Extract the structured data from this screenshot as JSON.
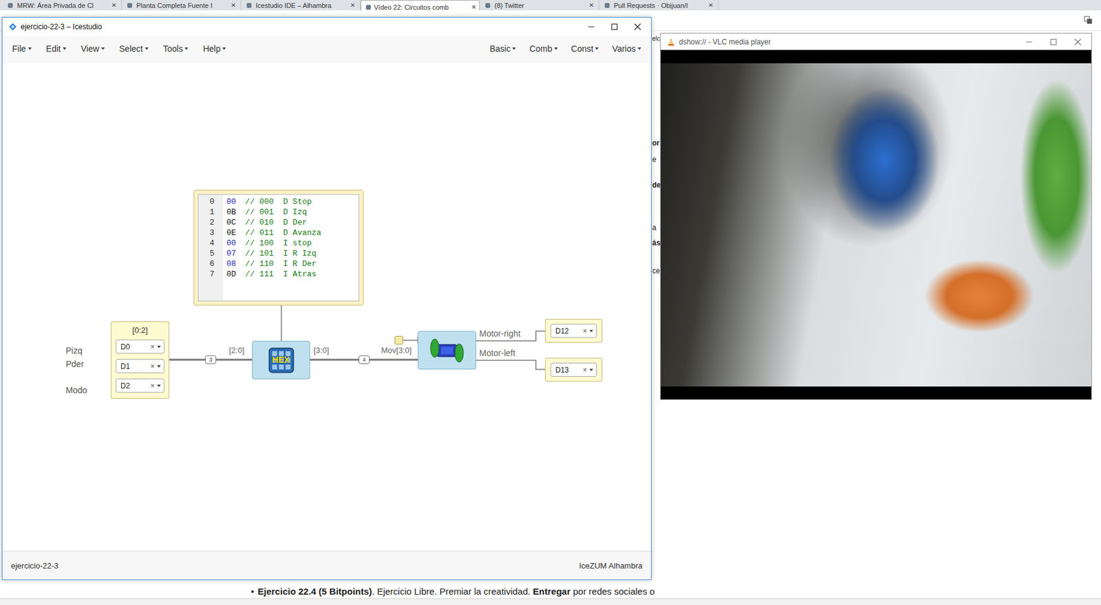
{
  "browser": {
    "tabs": [
      {
        "label": "MRW: Área Privada de Cl",
        "close": "✕",
        "selected": false
      },
      {
        "label": "Planta Completa Fuente I",
        "close": "✕",
        "selected": false
      },
      {
        "label": "Icestudio IDE – Alhambra",
        "close": "✕",
        "selected": false
      },
      {
        "label": "Vídeo 22: Circuitos comb",
        "close": "✕",
        "selected": true
      },
      {
        "label": "(8) Twitter",
        "close": "✕",
        "selected": false
      },
      {
        "label": "Pull Requests · Obijuan/I",
        "close": "✕",
        "selected": false
      }
    ]
  },
  "page": {
    "side": "elc",
    "fragments": [
      "or",
      "e",
      "de",
      "a",
      "ás",
      "ce"
    ],
    "bullet": {
      "mark": "•",
      "bold": "Ejercicio 22.4 (5 Bitpoints)",
      "text": ". Ejercicio Libre. Premiar la creatividad. ",
      "bold2": "Entregar",
      "rest": " por redes sociales o"
    }
  },
  "icestudio": {
    "title": "ejercicio-22-3 – Icestudio",
    "menu_left": [
      "File",
      "Edit",
      "View",
      "Select",
      "Tools",
      "Help"
    ],
    "menu_right": [
      "Basic",
      "Comb",
      "Const",
      "Varios"
    ],
    "memory": {
      "lines": [
        {
          "n": "0",
          "value": "00",
          "comment": "// 000  D Stop"
        },
        {
          "n": "1",
          "value": "0B",
          "comment": "// 001  D Izq"
        },
        {
          "n": "2",
          "value": "0C",
          "comment": "// 010  D Der"
        },
        {
          "n": "3",
          "value": "0E",
          "comment": "// 011  D Avanza"
        },
        {
          "n": "4",
          "value": "00",
          "comment": "// 100  I stop"
        },
        {
          "n": "5",
          "value": "07",
          "comment": "// 101  I R Izq"
        },
        {
          "n": "6",
          "value": "08",
          "comment": "// 110  I R Der"
        },
        {
          "n": "7",
          "value": "0D",
          "comment": "// 111  I Atras"
        }
      ]
    },
    "input": {
      "label": "[0:2]",
      "pins": [
        {
          "name": "Pizq",
          "pin": "D0",
          "clear": "×"
        },
        {
          "name": "Pder",
          "pin": "D1",
          "clear": "×"
        },
        {
          "name": "Modo",
          "pin": "D2",
          "clear": "×"
        }
      ]
    },
    "hex": {
      "label": "HEX",
      "in": "[2:0]",
      "out": "[3:0]"
    },
    "wires": [
      "3",
      "4"
    ],
    "motor": {
      "in": "Mov[3:0]",
      "outputs": [
        "Motor-right",
        "Motor-left"
      ]
    },
    "outputs": [
      {
        "pin": "D12",
        "clear": "×"
      },
      {
        "pin": "D13",
        "clear": "×"
      }
    ],
    "status": {
      "left": "ejercicio-22-3",
      "right": "IceZUM Alhambra"
    }
  },
  "vlc": {
    "title": "dshow:// - VLC media player"
  }
}
